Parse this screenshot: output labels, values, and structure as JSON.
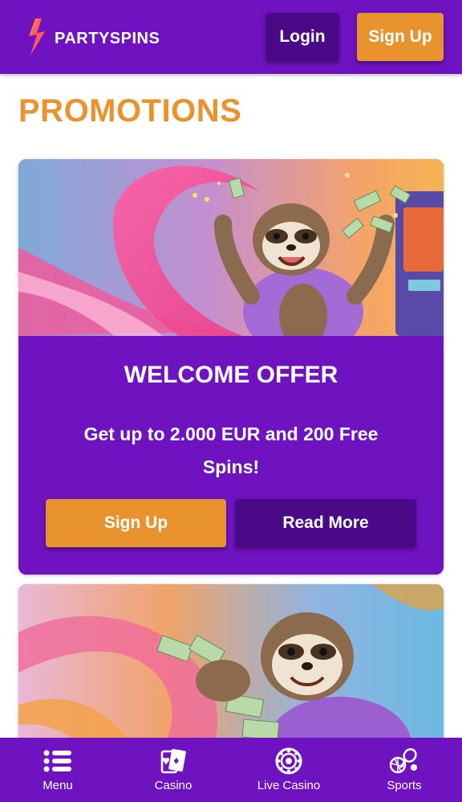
{
  "brand": {
    "name": "PARTYSPINS"
  },
  "header": {
    "login_label": "Login",
    "signup_label": "Sign Up"
  },
  "page": {
    "title": "PROMOTIONS"
  },
  "promotions": [
    {
      "title": "WELCOME OFFER",
      "description": "Get up to 2.000 EUR and 200 Free Spins!",
      "signup_label": "Sign Up",
      "read_more_label": "Read More",
      "image": "sloth-celebrating-with-money"
    },
    {
      "image": "sloth-holding-cash"
    }
  ],
  "bottom_nav": {
    "items": [
      {
        "label": "Menu",
        "icon": "menu-list-icon"
      },
      {
        "label": "Casino",
        "icon": "cards-icon"
      },
      {
        "label": "Live Casino",
        "icon": "roulette-icon"
      },
      {
        "label": "Sports",
        "icon": "sports-icon"
      }
    ]
  },
  "colors": {
    "primary_purple": "#6f12c0",
    "dark_purple": "#4a0a88",
    "accent_orange": "#e9932f"
  }
}
